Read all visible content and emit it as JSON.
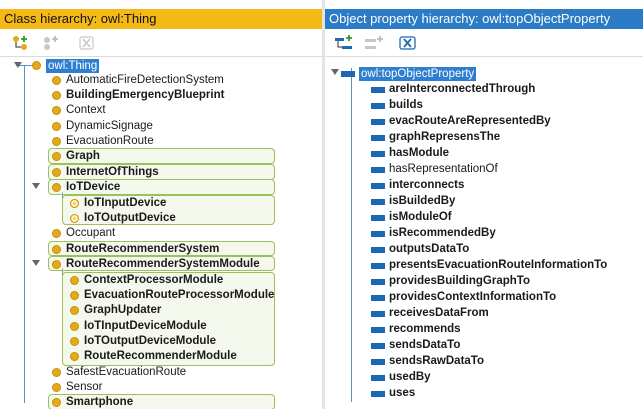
{
  "class_panel": {
    "title": "Class hierarchy: owl:Thing",
    "toolbar": [
      "add-subclass-icon",
      "add-sibling-class-icon",
      "delete-class-icon"
    ],
    "root": "owl:Thing",
    "items": [
      {
        "label": "AutomaticFireDetectionSystem"
      },
      {
        "label": "BuildingEmergencyBlueprint"
      },
      {
        "label": "Context"
      },
      {
        "label": "DynamicSignage"
      },
      {
        "label": "EvacuationRoute"
      },
      {
        "label": "Graph"
      },
      {
        "label": "InternetOfThings"
      },
      {
        "label": "IoTDevice",
        "expanded": true
      },
      {
        "label": "IoTInputDevice"
      },
      {
        "label": "IoTOutputDevice"
      },
      {
        "label": "Occupant"
      },
      {
        "label": "RouteRecommenderSystem"
      },
      {
        "label": "RouteRecommenderSystemModule",
        "expanded": true
      },
      {
        "label": "ContextProcessorModule"
      },
      {
        "label": "EvacuationRouteProcessorModule"
      },
      {
        "label": "GraphUpdater"
      },
      {
        "label": "IoTInputDeviceModule"
      },
      {
        "label": "IoTOutputDeviceModule"
      },
      {
        "label": "RouteRecommenderModule"
      },
      {
        "label": "SafestEvacuationRoute"
      },
      {
        "label": "Sensor"
      },
      {
        "label": "Smartphone"
      }
    ]
  },
  "property_panel": {
    "title": "Object property hierarchy: owl:topObjectProperty",
    "toolbar": [
      "add-subproperty-icon",
      "add-sibling-property-icon",
      "delete-property-icon"
    ],
    "root": "owl:topObjectProperty",
    "items": [
      "areInterconnectedThrough",
      "builds",
      "evacRouteAreRepresentedBy",
      "graphRepresensThe",
      "hasModule",
      "hasRepresentationOf",
      "interconnects",
      "isBuildedBy",
      "isModuleOf",
      "isRecommendedBy",
      "outputsDataTo",
      "presentsEvacuationRouteInformationTo",
      "providesBuildingGraphTo",
      "providesContextInformationTo",
      "receivesDataFrom",
      "recommends",
      "sendsDataTo",
      "sendsRawDataTo",
      "usedBy",
      "uses"
    ]
  },
  "colors": {
    "class_header": "#f4b916",
    "property_header": "#2b7bc6",
    "class_dot": "#e3ac17",
    "property_bar": "#1d68b5",
    "highlight_box": "#9cc05a"
  }
}
